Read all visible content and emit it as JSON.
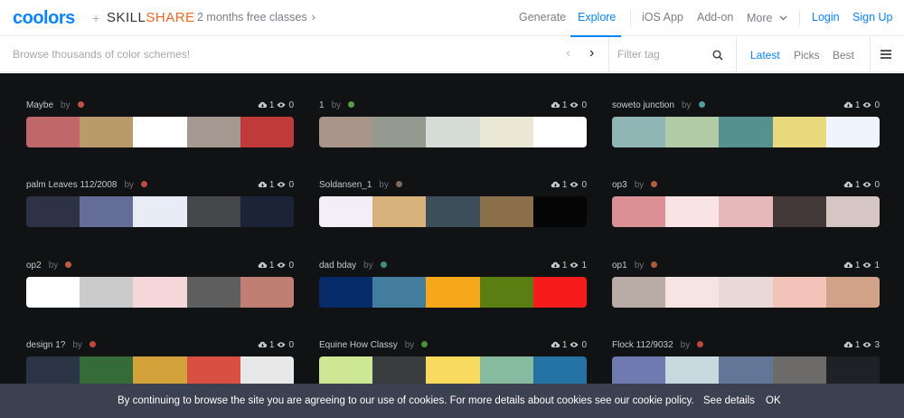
{
  "nav": {
    "logo": "coolors",
    "plus": "+",
    "partner_part1": "SKILL",
    "partner_part2": "SHARE",
    "promo": "2 months free classes",
    "links": [
      "Generate",
      "Explore",
      "iOS App",
      "Add-on",
      "More",
      "Login",
      "Sign Up"
    ],
    "active": "Explore"
  },
  "subbar": {
    "search_hint": "Browse thousands of color schemes!",
    "filter_placeholder": "Filter tag",
    "sort": [
      "Latest",
      "Picks",
      "Best"
    ],
    "active_sort": "Latest"
  },
  "palettes": [
    {
      "name": "Maybe",
      "by": "by",
      "dot": "#c0504d",
      "downloads": "1",
      "views": "0",
      "colors": [
        "#c0676a",
        "#b99b6b",
        "#ffffff",
        "#a59891",
        "#c0393b"
      ]
    },
    {
      "name": "1",
      "by": "by",
      "dot": "#5a9a4a",
      "downloads": "1",
      "views": "0",
      "colors": [
        "#a8968a",
        "#949a8f",
        "#d6ddd9",
        "#ebe8d6",
        "#ffffff"
      ]
    },
    {
      "name": "soweto junction",
      "by": "by",
      "dot": "#4f9f96",
      "downloads": "1",
      "views": "0",
      "colors": [
        "#8fb6b4",
        "#b0cba5",
        "#569190",
        "#e8da7c",
        "#eef5ff"
      ]
    },
    {
      "name": "palm Leaves 112/2008",
      "by": "by",
      "dot": "#c04a4a",
      "downloads": "1",
      "views": "0",
      "colors": [
        "#2d3245",
        "#646d98",
        "#e8ecf7",
        "#46474b",
        "#1d2336"
      ]
    },
    {
      "name": "Soldansen_1",
      "by": "by",
      "dot": "#7a6a5a",
      "downloads": "1",
      "views": "0",
      "colors": [
        "#f4eff7",
        "#d7b27a",
        "#3b4e5a",
        "#8b6f4a",
        "#050505"
      ]
    },
    {
      "name": "op3",
      "by": "by",
      "dot": "#b55b4b",
      "downloads": "1",
      "views": "0",
      "colors": [
        "#da9095",
        "#f7e4e3",
        "#e6b8ba",
        "#433938",
        "#d5c6c3"
      ]
    },
    {
      "name": "op2",
      "by": "by",
      "dot": "#c05a45",
      "downloads": "1",
      "views": "0",
      "colors": [
        "#ffffff",
        "#cbcbcb",
        "#f5d7d9",
        "#5e5e5e",
        "#c17f74"
      ]
    },
    {
      "name": "dad bday",
      "by": "by",
      "dot": "#3f8f7a",
      "downloads": "1",
      "views": "1",
      "colors": [
        "#062c6a",
        "#437d9d",
        "#f7a81a",
        "#5b7e12",
        "#f71b1b"
      ]
    },
    {
      "name": "op1",
      "by": "by",
      "dot": "#b0583f",
      "downloads": "1",
      "views": "1",
      "colors": [
        "#b9aca7",
        "#f6e4e3",
        "#e9d9d6",
        "#f2c4b9",
        "#d1a188"
      ]
    },
    {
      "name": "design 1?",
      "by": "by",
      "dot": "#c0473e",
      "downloads": "1",
      "views": "0",
      "colors": [
        "#2a3444",
        "#356b39",
        "#d3a23a",
        "#d95043",
        "#e8e8e8"
      ]
    },
    {
      "name": "Equine How Classy",
      "by": "by",
      "dot": "#4a8f3a",
      "downloads": "1",
      "views": "0",
      "colors": [
        "#cde794",
        "#3a3d40",
        "#f7da5e",
        "#86bba0",
        "#2473a4"
      ]
    },
    {
      "name": "Flock 112/9032",
      "by": "by",
      "dot": "#c0473e",
      "downloads": "1",
      "views": "3",
      "colors": [
        "#6f7ab0",
        "#c7d8df",
        "#637698",
        "#6d6b69",
        "#1f2126"
      ]
    }
  ],
  "cookie": {
    "text": "By continuing to browse the site you are agreeing to our use of cookies. For more details about cookies see our cookie policy.",
    "details": "See details",
    "ok": "OK"
  },
  "colors": {
    "accent": "#0a85ff",
    "brand_orange": "#f26722",
    "main_bg": "#111214",
    "cookie_bg": "#3c4151"
  }
}
